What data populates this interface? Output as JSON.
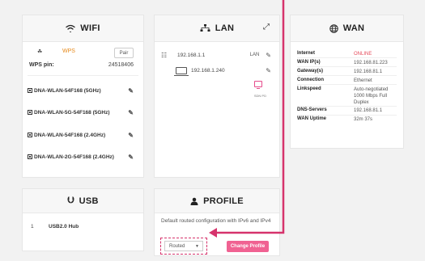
{
  "wifi": {
    "title": "WIFI",
    "wps_label": "WPS",
    "pair_label": "Pair",
    "wps_pin_label": "WPS pin:",
    "wps_pin_value": "24518406",
    "ssids": [
      "DNA-WLAN-54F168 (5GHz)",
      "DNA-WLAN-5G-54F168 (5GHz)",
      "DNA-WLAN-54F168 (2.4GHz)",
      "DNA-WLAN-2G-54F168 (2.4GHz)"
    ]
  },
  "lan": {
    "title": "LAN",
    "rows": [
      {
        "ip": "192.168.1.1",
        "tag": "LAN"
      },
      {
        "ip": "192.168.1.240",
        "tag": ""
      }
    ],
    "sub_tag": "SDN PD"
  },
  "wan": {
    "title": "WAN",
    "rows": [
      {
        "key": "Internet",
        "value": "ONLINE"
      },
      {
        "key": "WAN IP(s)",
        "value": "192.168.81.223"
      },
      {
        "key": "Gateway(s)",
        "value": "192.168.81.1"
      },
      {
        "key": "Connection",
        "value": "Ethernet"
      },
      {
        "key": "Linkspeed",
        "value": "Auto-negotiated 1000 Mbps Full Duplex"
      },
      {
        "key": "DNS-Servers",
        "value": "192.168.81.1"
      },
      {
        "key": "WAN Uptime",
        "value": "32m 37s"
      }
    ]
  },
  "usb": {
    "title": "USB",
    "rows": [
      {
        "index": "1",
        "name": "USB2.0 Hub"
      }
    ]
  },
  "profile": {
    "title": "PROFILE",
    "description": "Default routed configuration with IPv6 and IPv4",
    "select_value": "Routed",
    "change_label": "Change Profile"
  },
  "colors": {
    "accent_pink": "#f06292",
    "annotation": "#d6336c",
    "online": "#e64b5b",
    "wps": "#e6891a"
  }
}
